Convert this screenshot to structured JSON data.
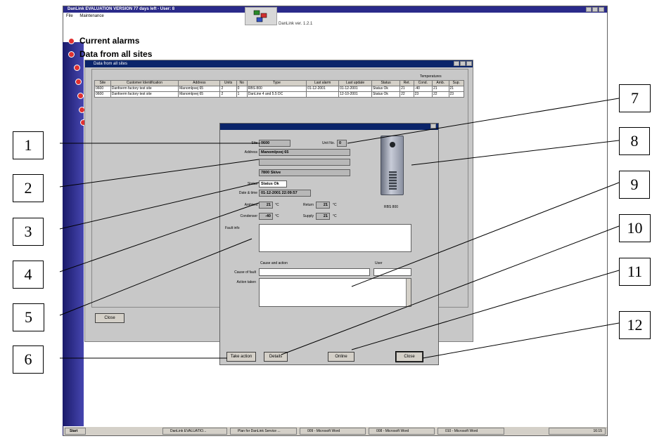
{
  "app": {
    "title": "DanLink EVALUATION VERSION  77 days left - User: 8",
    "menu": [
      "File",
      "Maintenance"
    ],
    "version": "DanLink ver. 1.2.1"
  },
  "side_menu": {
    "items": [
      "Current alarms",
      "Data from all sites"
    ]
  },
  "data_window": {
    "title": "Data from all sites",
    "temperatures_label": "Temperatures",
    "columns": [
      "Site",
      "Customer Identification",
      "Address",
      "Units",
      "No",
      "Type",
      "Last alarm",
      "Last update",
      "Status",
      "Ret.",
      "Cond.",
      "Amb.",
      "Sup."
    ],
    "rows": [
      [
        "0600",
        "Danfoerm factory test site",
        "Manomlpvej 65",
        "2",
        "0",
        "RBS 800",
        "01-12-2001",
        "01-12-2001",
        "Status Ok",
        "21",
        "-40",
        "21",
        "21"
      ],
      [
        "0600",
        "Danfoerm factory test site",
        "Manomlpvej 65",
        "2",
        "1",
        "DanLine 4 and 5.5 DC",
        "",
        "12-10-2001",
        "Status Ok",
        "22",
        "23",
        "22",
        "23"
      ]
    ],
    "close_label": "Close"
  },
  "dialog": {
    "site_label": "Site",
    "site_value": "0600",
    "unit_label": "Unit No.",
    "unit_value": "0",
    "address_label": "Address",
    "address_line1": "Manomlpvej 65",
    "address_line2": "",
    "address_line3": "7800  Skive",
    "status_label": "Status",
    "status_value": "Status Ok",
    "datetime_label": "Date & time",
    "datetime_value": "01-12-2001 22:09:57",
    "ambient_label": "Ambient",
    "ambient_value": "21",
    "return_label": "Return",
    "return_value": "21",
    "condenser_label": "Condenser",
    "condenser_value": "-40",
    "supply_label": "Supply",
    "supply_value": "21",
    "unit_symbol": "°C",
    "fault_label": "Fault info",
    "cause_action_header": "Cause and action",
    "user_label": "User",
    "cause_label": "Cause of fault",
    "action_label": "Action taken",
    "device_label": "RBS 800",
    "buttons": {
      "take_action": "Take action",
      "details": "Details",
      "online": "Online",
      "close": "Close"
    }
  },
  "callouts": [
    "1",
    "2",
    "3",
    "4",
    "5",
    "6",
    "7",
    "8",
    "9",
    "10",
    "11",
    "12"
  ],
  "taskbar": {
    "start": "Start",
    "tasks": [
      "DanLink EVALUATIO...",
      "Plan for DanLink Service ...",
      "009 - Microsoft Word",
      "008 - Microsoft Word",
      "010 - Microsoft Word"
    ],
    "clock": "16:15"
  }
}
